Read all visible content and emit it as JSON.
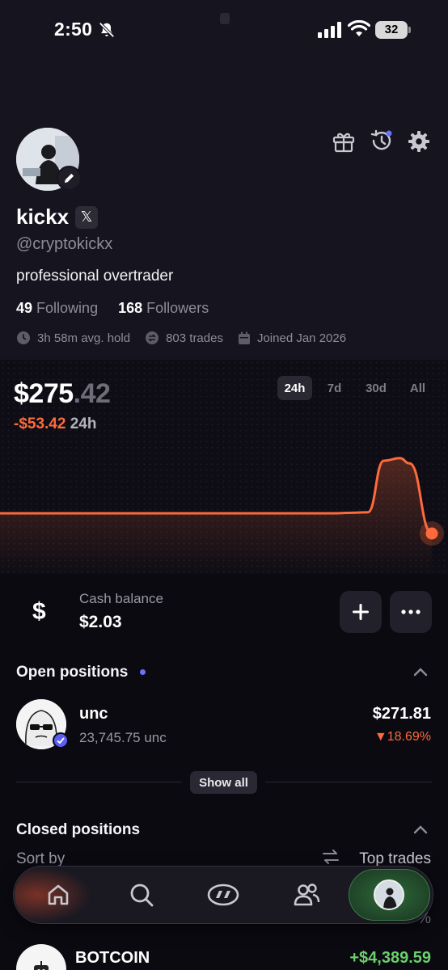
{
  "status_bar": {
    "time": "2:50",
    "battery": "32"
  },
  "profile": {
    "username": "kickx",
    "x_badge": "𝕏",
    "handle": "@cryptokickx",
    "bio": "professional overtrader",
    "following_count": "49",
    "following_label": "Following",
    "followers_count": "168",
    "followers_label": "Followers",
    "avg_hold": "3h 58m avg. hold",
    "trades": "803 trades",
    "joined": "Joined Jan 2026"
  },
  "portfolio": {
    "value_whole": "$275",
    "value_cents": ".42",
    "change": "-$53.42",
    "change_period": "24h",
    "ranges": [
      "24h",
      "7d",
      "30d",
      "All"
    ],
    "active_range": "24h",
    "accent_color": "#ff6a3d"
  },
  "chart_data": {
    "type": "line",
    "period": "24h",
    "series": [
      {
        "values": [
          1.0,
          1.0,
          1.0,
          1.0,
          1.0,
          1.0,
          1.0,
          1.0,
          1.0,
          1.0,
          1.0,
          1.0,
          1.0,
          1.0,
          1.0,
          1.0,
          1.0,
          1.0,
          1.0,
          1.0,
          1.0,
          1.0,
          1.01,
          1.02,
          2.0,
          2.05,
          1.95,
          0.0
        ]
      }
    ]
  },
  "cash": {
    "icon": "dollar-sign",
    "label": "Cash balance",
    "value": "$2.03"
  },
  "open_positions": {
    "title": "Open positions",
    "items": [
      {
        "name": "unc",
        "quantity": "23,745.75 unc",
        "value": "$271.81",
        "change": "▼18.69%"
      }
    ],
    "show_all": "Show all"
  },
  "closed_positions": {
    "title": "Closed positions",
    "sort_label": "Sort by",
    "sort_value": "Top trades",
    "faded_value": "%",
    "items": [
      {
        "name": "BOTCOIN",
        "pnl": "+$4,389.59",
        "pnl_color": "#6ad06a"
      }
    ]
  },
  "tab_bar": {
    "items": [
      "home-icon",
      "search-icon",
      "trending-icon",
      "people-icon",
      "profile-avatar"
    ],
    "active": "profile-avatar"
  }
}
